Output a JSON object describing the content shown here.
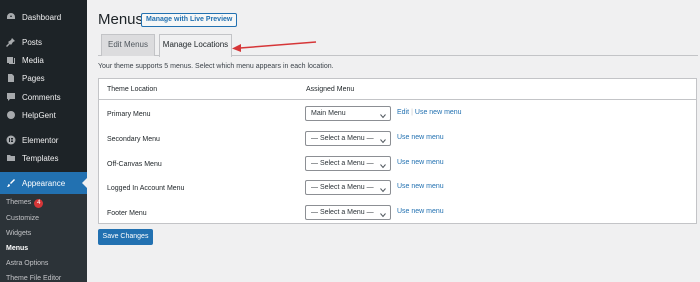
{
  "sidebar": {
    "items": [
      {
        "label": "Dashboard",
        "icon": "dashboard-icon"
      },
      {
        "label": "Posts",
        "icon": "pin-icon"
      },
      {
        "label": "Media",
        "icon": "media-icon"
      },
      {
        "label": "Pages",
        "icon": "page-icon"
      },
      {
        "label": "Comments",
        "icon": "comment-icon"
      },
      {
        "label": "HelpGent",
        "icon": "help-icon"
      },
      {
        "label": "Elementor",
        "icon": "elementor-icon"
      },
      {
        "label": "Templates",
        "icon": "folder-icon"
      },
      {
        "label": "Appearance",
        "icon": "brush-icon"
      }
    ],
    "submenu": [
      {
        "label": "Themes",
        "badge": "4"
      },
      {
        "label": "Customize"
      },
      {
        "label": "Widgets"
      },
      {
        "label": "Menus"
      },
      {
        "label": "Astra Options"
      },
      {
        "label": "Theme File Editor"
      }
    ]
  },
  "header": {
    "title": "Menus",
    "preview_button": "Manage with Live Preview"
  },
  "tabs": [
    {
      "label": "Edit Menus"
    },
    {
      "label": "Manage Locations"
    }
  ],
  "intro": "Your theme supports 5 menus. Select which menu appears in each location.",
  "table": {
    "headers": [
      "Theme Location",
      "Assigned Menu"
    ],
    "rows": [
      {
        "location": "Primary Menu",
        "selected": "Main Menu",
        "edit": "Edit",
        "new": "Use new menu"
      },
      {
        "location": "Secondary Menu",
        "selected": "— Select a Menu —",
        "new": "Use new menu"
      },
      {
        "location": "Off-Canvas Menu",
        "selected": "— Select a Menu —",
        "new": "Use new menu"
      },
      {
        "location": "Logged In Account Menu",
        "selected": "— Select a Menu —",
        "new": "Use new menu"
      },
      {
        "location": "Footer Menu",
        "selected": "— Select a Menu —",
        "new": "Use new menu"
      }
    ]
  },
  "save_button": "Save Changes",
  "colors": {
    "accent": "#2271b1",
    "sidebar": "#1d2327",
    "annotation_arrow": "#d63638"
  }
}
